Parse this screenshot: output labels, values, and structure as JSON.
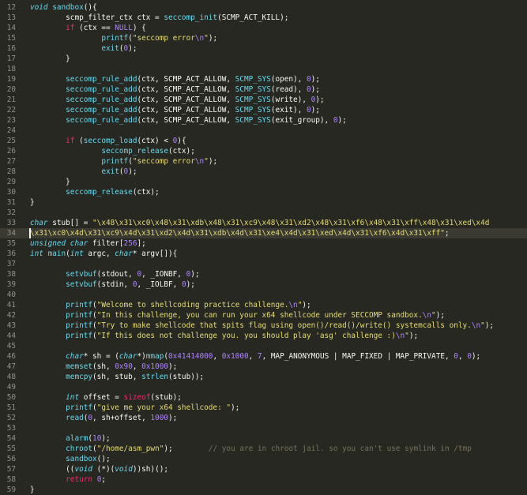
{
  "editor": {
    "current_line": "34",
    "lines": [
      {
        "n": "12",
        "t": [
          {
            "c": "ty",
            "s": "void"
          },
          {
            "s": " "
          },
          {
            "c": "fn",
            "s": "sandbox"
          },
          {
            "s": "(){"
          }
        ]
      },
      {
        "n": "13",
        "t": [
          {
            "s": "        scmp_filter_ctx ctx = "
          },
          {
            "c": "fn",
            "s": "seccomp_init"
          },
          {
            "s": "(SCMP_ACT_KILL);"
          }
        ]
      },
      {
        "n": "14",
        "t": [
          {
            "s": "        "
          },
          {
            "c": "kw",
            "s": "if"
          },
          {
            "s": " (ctx == "
          },
          {
            "c": "nu",
            "s": "NULL"
          },
          {
            "s": ") {"
          }
        ]
      },
      {
        "n": "15",
        "t": [
          {
            "s": "                "
          },
          {
            "c": "fn",
            "s": "printf"
          },
          {
            "s": "("
          },
          {
            "c": "st",
            "s": "\"seccomp error"
          },
          {
            "c": "nu",
            "s": "\\n"
          },
          {
            "c": "st",
            "s": "\""
          },
          {
            "s": ");"
          }
        ]
      },
      {
        "n": "16",
        "t": [
          {
            "s": "                "
          },
          {
            "c": "fn",
            "s": "exit"
          },
          {
            "s": "("
          },
          {
            "c": "nu",
            "s": "0"
          },
          {
            "s": ");"
          }
        ]
      },
      {
        "n": "17",
        "t": [
          {
            "s": "        }"
          }
        ]
      },
      {
        "n": "18",
        "t": []
      },
      {
        "n": "19",
        "t": [
          {
            "s": "        "
          },
          {
            "c": "fn",
            "s": "seccomp_rule_add"
          },
          {
            "s": "(ctx, SCMP_ACT_ALLOW, "
          },
          {
            "c": "fn",
            "s": "SCMP_SYS"
          },
          {
            "s": "(open), "
          },
          {
            "c": "nu",
            "s": "0"
          },
          {
            "s": ");"
          }
        ]
      },
      {
        "n": "20",
        "t": [
          {
            "s": "        "
          },
          {
            "c": "fn",
            "s": "seccomp_rule_add"
          },
          {
            "s": "(ctx, SCMP_ACT_ALLOW, "
          },
          {
            "c": "fn",
            "s": "SCMP_SYS"
          },
          {
            "s": "(read), "
          },
          {
            "c": "nu",
            "s": "0"
          },
          {
            "s": ");"
          }
        ]
      },
      {
        "n": "21",
        "t": [
          {
            "s": "        "
          },
          {
            "c": "fn",
            "s": "seccomp_rule_add"
          },
          {
            "s": "(ctx, SCMP_ACT_ALLOW, "
          },
          {
            "c": "fn",
            "s": "SCMP_SYS"
          },
          {
            "s": "(write), "
          },
          {
            "c": "nu",
            "s": "0"
          },
          {
            "s": ");"
          }
        ]
      },
      {
        "n": "22",
        "t": [
          {
            "s": "        "
          },
          {
            "c": "fn",
            "s": "seccomp_rule_add"
          },
          {
            "s": "(ctx, SCMP_ACT_ALLOW, "
          },
          {
            "c": "fn",
            "s": "SCMP_SYS"
          },
          {
            "s": "(exit), "
          },
          {
            "c": "nu",
            "s": "0"
          },
          {
            "s": ");"
          }
        ]
      },
      {
        "n": "23",
        "t": [
          {
            "s": "        "
          },
          {
            "c": "fn",
            "s": "seccomp_rule_add"
          },
          {
            "s": "(ctx, SCMP_ACT_ALLOW, "
          },
          {
            "c": "fn",
            "s": "SCMP_SYS"
          },
          {
            "s": "(exit_group), "
          },
          {
            "c": "nu",
            "s": "0"
          },
          {
            "s": ");"
          }
        ]
      },
      {
        "n": "24",
        "t": []
      },
      {
        "n": "25",
        "t": [
          {
            "s": "        "
          },
          {
            "c": "kw",
            "s": "if"
          },
          {
            "s": " ("
          },
          {
            "c": "fn",
            "s": "seccomp_load"
          },
          {
            "s": "(ctx) < "
          },
          {
            "c": "nu",
            "s": "0"
          },
          {
            "s": "){"
          }
        ]
      },
      {
        "n": "26",
        "t": [
          {
            "s": "                "
          },
          {
            "c": "fn",
            "s": "seccomp_release"
          },
          {
            "s": "(ctx);"
          }
        ]
      },
      {
        "n": "27",
        "t": [
          {
            "s": "                "
          },
          {
            "c": "fn",
            "s": "printf"
          },
          {
            "s": "("
          },
          {
            "c": "st",
            "s": "\"seccomp error"
          },
          {
            "c": "nu",
            "s": "\\n"
          },
          {
            "c": "st",
            "s": "\""
          },
          {
            "s": ");"
          }
        ]
      },
      {
        "n": "28",
        "t": [
          {
            "s": "                "
          },
          {
            "c": "fn",
            "s": "exit"
          },
          {
            "s": "("
          },
          {
            "c": "nu",
            "s": "0"
          },
          {
            "s": ");"
          }
        ]
      },
      {
        "n": "29",
        "t": [
          {
            "s": "        }"
          }
        ]
      },
      {
        "n": "30",
        "t": [
          {
            "s": "        "
          },
          {
            "c": "fn",
            "s": "seccomp_release"
          },
          {
            "s": "(ctx);"
          }
        ]
      },
      {
        "n": "31",
        "t": [
          {
            "s": "}"
          }
        ]
      },
      {
        "n": "32",
        "t": []
      },
      {
        "n": "33",
        "t": [
          {
            "c": "ty",
            "s": "char"
          },
          {
            "s": " stub[] = "
          },
          {
            "c": "st",
            "s": "\"\\x48\\x31\\xc0\\x48\\x31\\xdb\\x48\\x31\\xc9\\x48\\x31\\xd2\\x48\\x31\\xf6\\x48\\x31\\xff\\x48\\x31\\xed\\x4d"
          }
        ]
      },
      {
        "n": "34",
        "t": [
          {
            "c": "st",
            "s": "\\x31\\xc0\\x4d\\x31\\xc9\\x4d\\x31\\xd2\\x4d\\x31\\xdb\\x4d\\x31\\xe4\\x4d\\x31\\xed\\x4d\\x31\\xf6\\x4d\\x31\\xff\""
          },
          {
            "s": ";"
          }
        ]
      },
      {
        "n": "35",
        "t": [
          {
            "c": "ty",
            "s": "unsigned char"
          },
          {
            "s": " filter["
          },
          {
            "c": "nu",
            "s": "256"
          },
          {
            "s": "];"
          }
        ]
      },
      {
        "n": "36",
        "t": [
          {
            "c": "ty",
            "s": "int"
          },
          {
            "s": " "
          },
          {
            "c": "fn",
            "s": "main"
          },
          {
            "s": "("
          },
          {
            "c": "ty",
            "s": "int"
          },
          {
            "s": " argc, "
          },
          {
            "c": "ty",
            "s": "char"
          },
          {
            "s": "* argv[]){"
          }
        ]
      },
      {
        "n": "37",
        "t": []
      },
      {
        "n": "38",
        "t": [
          {
            "s": "        "
          },
          {
            "c": "fn",
            "s": "setvbuf"
          },
          {
            "s": "(stdout, "
          },
          {
            "c": "nu",
            "s": "0"
          },
          {
            "s": ", _IONBF, "
          },
          {
            "c": "nu",
            "s": "0"
          },
          {
            "s": ");"
          }
        ]
      },
      {
        "n": "39",
        "t": [
          {
            "s": "        "
          },
          {
            "c": "fn",
            "s": "setvbuf"
          },
          {
            "s": "(stdin, "
          },
          {
            "c": "nu",
            "s": "0"
          },
          {
            "s": ", _IOLBF, "
          },
          {
            "c": "nu",
            "s": "0"
          },
          {
            "s": ");"
          }
        ]
      },
      {
        "n": "40",
        "t": []
      },
      {
        "n": "41",
        "t": [
          {
            "s": "        "
          },
          {
            "c": "fn",
            "s": "printf"
          },
          {
            "s": "("
          },
          {
            "c": "st",
            "s": "\"Welcome to shellcoding practice challenge."
          },
          {
            "c": "nu",
            "s": "\\n"
          },
          {
            "c": "st",
            "s": "\""
          },
          {
            "s": ");"
          }
        ]
      },
      {
        "n": "42",
        "t": [
          {
            "s": "        "
          },
          {
            "c": "fn",
            "s": "printf"
          },
          {
            "s": "("
          },
          {
            "c": "st",
            "s": "\"In this challenge, you can run your x64 shellcode under SECCOMP sandbox."
          },
          {
            "c": "nu",
            "s": "\\n"
          },
          {
            "c": "st",
            "s": "\""
          },
          {
            "s": ");"
          }
        ]
      },
      {
        "n": "43",
        "t": [
          {
            "s": "        "
          },
          {
            "c": "fn",
            "s": "printf"
          },
          {
            "s": "("
          },
          {
            "c": "st",
            "s": "\"Try to make shellcode that spits flag using open()/read()/write() systemcalls only."
          },
          {
            "c": "nu",
            "s": "\\n"
          },
          {
            "c": "st",
            "s": "\""
          },
          {
            "s": ");"
          }
        ]
      },
      {
        "n": "44",
        "t": [
          {
            "s": "        "
          },
          {
            "c": "fn",
            "s": "printf"
          },
          {
            "s": "("
          },
          {
            "c": "st",
            "s": "\"If this does not challenge you. you should play 'asg' challenge :)"
          },
          {
            "c": "nu",
            "s": "\\n"
          },
          {
            "c": "st",
            "s": "\""
          },
          {
            "s": ");"
          }
        ]
      },
      {
        "n": "45",
        "t": []
      },
      {
        "n": "46",
        "t": [
          {
            "s": "        "
          },
          {
            "c": "ty",
            "s": "char"
          },
          {
            "s": "* sh = ("
          },
          {
            "c": "ty",
            "s": "char"
          },
          {
            "s": "*)"
          },
          {
            "c": "fn",
            "s": "mmap"
          },
          {
            "s": "("
          },
          {
            "c": "nu",
            "s": "0x41414000"
          },
          {
            "s": ", "
          },
          {
            "c": "nu",
            "s": "0x1000"
          },
          {
            "s": ", "
          },
          {
            "c": "nu",
            "s": "7"
          },
          {
            "s": ", MAP_ANONYMOUS | MAP_FIXED | MAP_PRIVATE, "
          },
          {
            "c": "nu",
            "s": "0"
          },
          {
            "s": ", "
          },
          {
            "c": "nu",
            "s": "0"
          },
          {
            "s": ");"
          }
        ]
      },
      {
        "n": "47",
        "t": [
          {
            "s": "        "
          },
          {
            "c": "fn",
            "s": "memset"
          },
          {
            "s": "(sh, "
          },
          {
            "c": "nu",
            "s": "0x90"
          },
          {
            "s": ", "
          },
          {
            "c": "nu",
            "s": "0x1000"
          },
          {
            "s": ");"
          }
        ]
      },
      {
        "n": "48",
        "t": [
          {
            "s": "        "
          },
          {
            "c": "fn",
            "s": "memcpy"
          },
          {
            "s": "(sh, stub, "
          },
          {
            "c": "fn",
            "s": "strlen"
          },
          {
            "s": "(stub));"
          }
        ]
      },
      {
        "n": "49",
        "t": []
      },
      {
        "n": "50",
        "t": [
          {
            "s": "        "
          },
          {
            "c": "ty",
            "s": "int"
          },
          {
            "s": " offset = "
          },
          {
            "c": "kw",
            "s": "sizeof"
          },
          {
            "s": "(stub);"
          }
        ]
      },
      {
        "n": "51",
        "t": [
          {
            "s": "        "
          },
          {
            "c": "fn",
            "s": "printf"
          },
          {
            "s": "("
          },
          {
            "c": "st",
            "s": "\"give me your x64 shellcode: \""
          },
          {
            "s": ");"
          }
        ]
      },
      {
        "n": "52",
        "t": [
          {
            "s": "        "
          },
          {
            "c": "fn",
            "s": "read"
          },
          {
            "s": "("
          },
          {
            "c": "nu",
            "s": "0"
          },
          {
            "s": ", sh+offset, "
          },
          {
            "c": "nu",
            "s": "1000"
          },
          {
            "s": ");"
          }
        ]
      },
      {
        "n": "53",
        "t": []
      },
      {
        "n": "54",
        "t": [
          {
            "s": "        "
          },
          {
            "c": "fn",
            "s": "alarm"
          },
          {
            "s": "("
          },
          {
            "c": "nu",
            "s": "10"
          },
          {
            "s": ");"
          }
        ]
      },
      {
        "n": "55",
        "t": [
          {
            "s": "        "
          },
          {
            "c": "fn",
            "s": "chroot"
          },
          {
            "s": "("
          },
          {
            "c": "st",
            "s": "\"/home/asm_pwn\""
          },
          {
            "s": ");        "
          },
          {
            "c": "cm",
            "s": "// you are in chroot jail. so you can't use symlink in /tmp"
          }
        ]
      },
      {
        "n": "56",
        "t": [
          {
            "s": "        "
          },
          {
            "c": "fn",
            "s": "sandbox"
          },
          {
            "s": "();"
          }
        ]
      },
      {
        "n": "57",
        "t": [
          {
            "s": "        (("
          },
          {
            "c": "ty",
            "s": "void"
          },
          {
            "s": " (*)("
          },
          {
            "c": "ty",
            "s": "void"
          },
          {
            "s": "))sh)();"
          }
        ]
      },
      {
        "n": "58",
        "t": [
          {
            "s": "        "
          },
          {
            "c": "kw",
            "s": "return"
          },
          {
            "s": " "
          },
          {
            "c": "nu",
            "s": "0"
          },
          {
            "s": ";"
          }
        ]
      },
      {
        "n": "59",
        "t": [
          {
            "s": "}"
          }
        ]
      }
    ]
  }
}
